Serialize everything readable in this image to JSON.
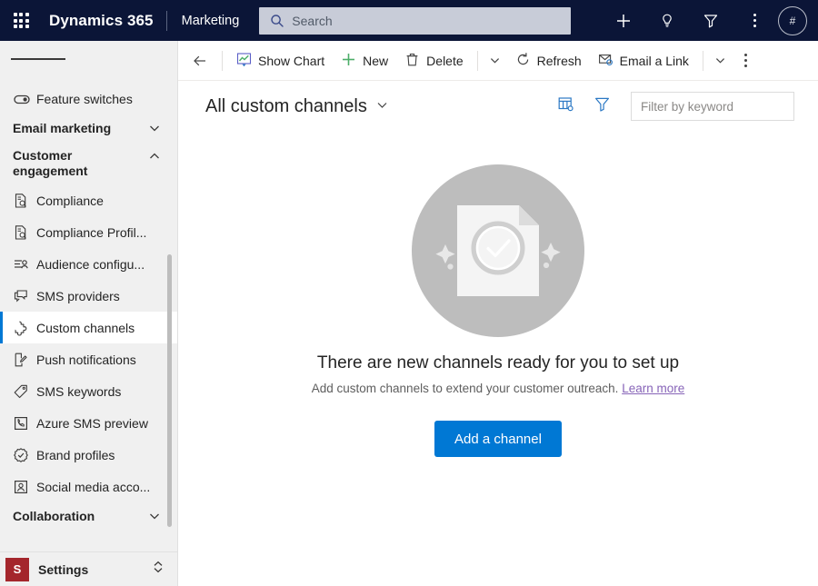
{
  "header": {
    "waffle_label": "app-launcher",
    "brand": "Dynamics 365",
    "app_name": "Marketing",
    "search_placeholder": "Search",
    "search_value": "",
    "icons": {
      "add": "plus-icon",
      "insights": "lightbulb-icon",
      "filter": "funnel-icon",
      "more": "more-vertical-icon"
    },
    "avatar_initials": "#"
  },
  "sidebar": {
    "hamburger_label": "Show/Hide navigation",
    "top_items": [
      {
        "label": "Feature switches",
        "icon": "toggle-icon"
      }
    ],
    "groups": [
      {
        "label": "Email marketing",
        "expanded": false,
        "chevron": "chevron-down-icon"
      },
      {
        "label": "Customer engagement",
        "expanded": true,
        "chevron": "chevron-up-icon"
      },
      {
        "label": "Collaboration",
        "expanded": false,
        "chevron": "chevron-down-icon"
      }
    ],
    "items": [
      {
        "label": "Compliance",
        "icon": "document-search-icon",
        "selected": false
      },
      {
        "label": "Compliance Profil...",
        "icon": "document-search-icon",
        "selected": false
      },
      {
        "label": "Audience configu...",
        "icon": "audience-list-icon",
        "selected": false
      },
      {
        "label": "SMS providers",
        "icon": "chat-bubble-icon",
        "selected": false
      },
      {
        "label": "Custom channels",
        "icon": "puzzle-piece-icon",
        "selected": true
      },
      {
        "label": "Push notifications",
        "icon": "push-notification-icon",
        "selected": false
      },
      {
        "label": "SMS keywords",
        "icon": "tag-icon",
        "selected": false
      },
      {
        "label": "Azure SMS preview",
        "icon": "phone-box-icon",
        "selected": false
      },
      {
        "label": "Brand profiles",
        "icon": "seal-check-icon",
        "selected": false
      },
      {
        "label": "Social media acco...",
        "icon": "person-frame-icon",
        "selected": false
      }
    ],
    "area_switcher": {
      "badge": "S",
      "label": "Settings",
      "chevron": "updown-chevron-icon"
    }
  },
  "commandbar": {
    "back_label": "back-arrow-icon",
    "buttons": [
      {
        "label": "Show Chart",
        "icon": "chart-icon"
      },
      {
        "label": "New",
        "icon": "plus-icon"
      },
      {
        "label": "Delete",
        "icon": "trash-icon"
      },
      {
        "label": "Refresh",
        "icon": "refresh-icon"
      },
      {
        "label": "Email a Link",
        "icon": "email-link-icon"
      }
    ],
    "caret_label": "chevron-down-icon",
    "overflow_label": "more-vertical-icon"
  },
  "viewbar": {
    "title": "All custom channels",
    "title_chevron": "chevron-down-icon",
    "edit_columns_icon": "edit-columns-icon",
    "filter_icon": "funnel-icon",
    "filter_placeholder": "Filter by keyword",
    "filter_value": ""
  },
  "empty_state": {
    "illustration": "document-check-sparkles-illustration",
    "title": "There are new channels ready for you to set up",
    "subtitle_text": "Add custom channels to extend your customer outreach. ",
    "subtitle_link": "Learn more",
    "button_label": "Add a channel"
  },
  "colors": {
    "header_bg": "#0b1537",
    "accent": "#0078d4",
    "sidebar_bg": "#f0f0f0",
    "area_badge": "#a4262c",
    "link": "#8764b8",
    "new_icon_green": "#4cae68"
  }
}
